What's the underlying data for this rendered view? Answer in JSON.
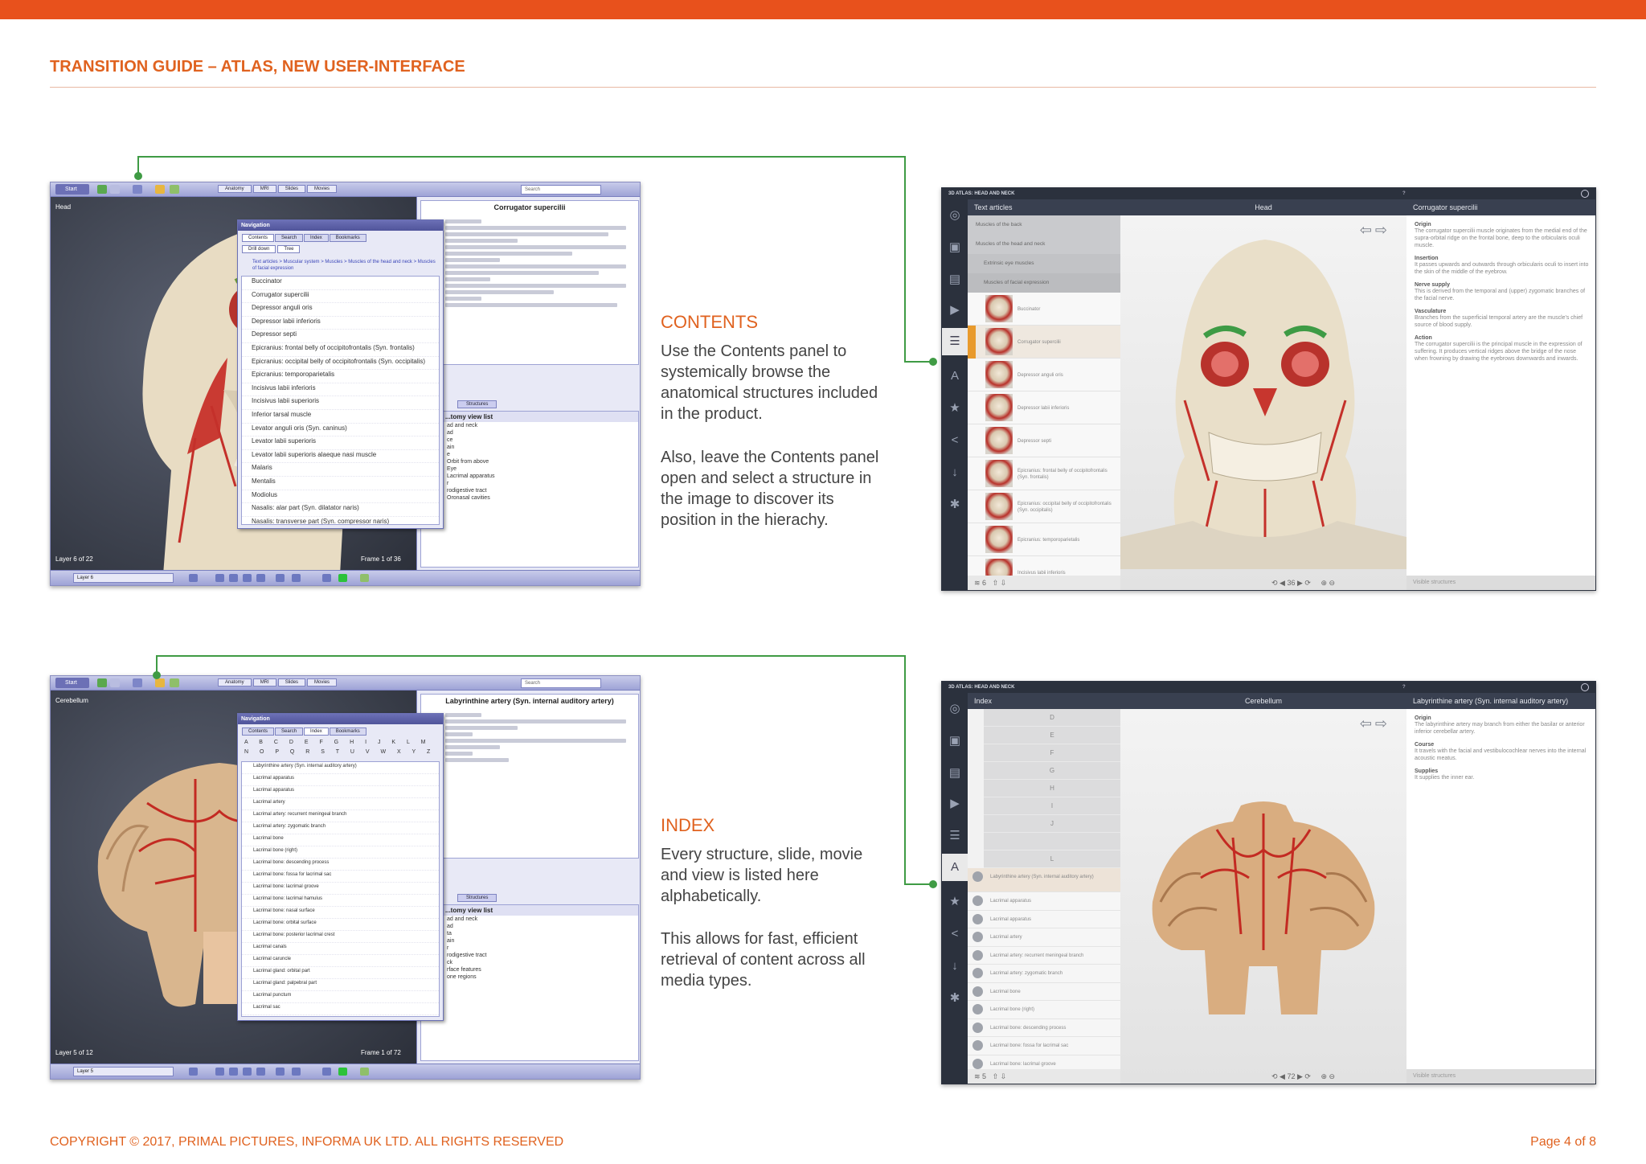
{
  "header": {
    "title": "TRANSITION GUIDE – ATLAS, NEW USER-INTERFACE"
  },
  "footer": {
    "copyright": "COPYRIGHT © 2017, PRIMAL PICTURES, INFORMA UK LTD. ALL RIGHTS RESERVED",
    "page": "Page 4 of  8"
  },
  "colors": {
    "accent": "#e8511c",
    "connector": "#3f9b44"
  },
  "contents_section": {
    "heading": "CONTENTS",
    "para1": "Use the Contents panel to systemically browse the anatomical structures included in the product.",
    "para2": "Also, leave the Contents panel open and select a structure in the image to discover its position in the hierachy."
  },
  "index_section": {
    "heading": "INDEX",
    "para1": "Every structure, slide, movie and view is listed here alphabetically.",
    "para2": "This allows for fast, efficient retrieval of content across all media types."
  },
  "old_ui": {
    "start": "Start",
    "tabs": [
      "Anatomy",
      "MRI",
      "Slides",
      "Movies"
    ],
    "search_placeholder": "Search",
    "nav_title": "Navigation",
    "nav_tabs": [
      "Contents",
      "Search",
      "Index",
      "Bookmarks"
    ],
    "structures_tab": "Structures",
    "view_list_title": "...tomy view list",
    "contents": {
      "view_label": "Head",
      "layer_status": "Layer 6 of 22",
      "frame_status": "Frame 1 of 36",
      "layer_select": "Layer 6",
      "article_title": "Corrugator supercilii",
      "sub_tabs": [
        "Drill down",
        "Tree"
      ],
      "breadcrumb": "Text articles > Muscular system > Muscles > Muscles of the head and neck > Muscles of facial expression",
      "items": [
        "Buccinator",
        "Corrugator supercilii",
        "Depressor anguli oris",
        "Depressor labii inferioris",
        "Depressor septi",
        "Epicranius: frontal belly of occipitofrontalis (Syn. frontalis)",
        "Epicranius: occipital belly of occipitofrontalis (Syn. occipitalis)",
        "Epicranius: temporoparietalis",
        "Incisivus labii inferioris",
        "Incisivus labii superioris",
        "Inferior tarsal muscle",
        "Levator anguli oris (Syn. caninus)",
        "Levator labii superioris",
        "Levator labii superioris alaeque nasi muscle",
        "Malaris",
        "Mentalis",
        "Modiolus",
        "Nasalis: alar part (Syn. dilatator naris)",
        "Nasalis: transverse part (Syn. compressor naris)"
      ],
      "view_list": [
        "ad and neck",
        "ad",
        "ce",
        "ain",
        "e",
        "Orbit from above",
        "Eye",
        "Lacrimal apparatus",
        "r",
        "rodigestive tract",
        "Oronasal cavities"
      ]
    },
    "index": {
      "view_label": "Cerebellum",
      "layer_status": "Layer 5 of 12",
      "frame_status": "Frame 1 of 72",
      "layer_select": "Layer 5",
      "article_title": "Labyrinthine artery (Syn. internal auditory artery)",
      "alphabet": "A B C D E F G H I J K L M N O P Q R S T U V W X Y Z",
      "items": [
        "Labyrinthine artery (Syn. internal auditory artery)",
        "Lacrimal apparatus",
        "Lacrimal apparatus",
        "Lacrimal artery",
        "Lacrimal artery: recurrent meningeal branch",
        "Lacrimal artery: zygomatic branch",
        "Lacrimal bone",
        "Lacrimal bone (right)",
        "Lacrimal bone: descending process",
        "Lacrimal bone: fossa for lacrimal sac",
        "Lacrimal bone: lacrimal groove",
        "Lacrimal bone: lacrimal hamulus",
        "Lacrimal bone: nasal surface",
        "Lacrimal bone: orbital surface",
        "Lacrimal bone: posterior lacrimal crest",
        "Lacrimal canals",
        "Lacrimal caruncle",
        "Lacrimal gland: orbital part",
        "Lacrimal gland: palpebral part",
        "Lacrimal punctum",
        "Lacrimal sac"
      ],
      "view_list": [
        "ad and neck",
        "ad",
        "ta",
        "ain",
        "r",
        "rodigestive tract",
        "ck",
        "rface features",
        "one regions"
      ]
    }
  },
  "new_ui": {
    "app_title": "3D ATLAS: HEAD AND NECK",
    "visible_structures": "Visible structures",
    "contents": {
      "left_header": "Text articles",
      "mid_header": "Head",
      "right_header": "Corrugator supercilii",
      "frame": "36",
      "layer": "6",
      "tree": [
        "Muscles of the back",
        "Muscles of the head and neck",
        "Extrinsic eye muscles",
        "Muscles of facial expression"
      ],
      "thumbs": [
        "Buccinator",
        "Corrugator supercilii",
        "Depressor anguli oris",
        "Depressor labii inferioris",
        "Depressor septi",
        "Epicranius: frontal belly of occipitofrontalis (Syn. frontalis)",
        "Epicranius: occipital belly of occipitofrontalis (Syn. occipitalis)",
        "Epicranius: temporoparietalis",
        "Incisivus labii inferioris"
      ],
      "article": [
        {
          "t": "Origin",
          "b": "The corrugator supercilii muscle originates from the medial end of the supra-orbital ridge on the frontal bone, deep to the orbicularis oculi muscle."
        },
        {
          "t": "Insertion",
          "b": "It passes upwards and outwards through orbicularis oculi to insert into the skin of the middle of the eyebrow."
        },
        {
          "t": "Nerve supply",
          "b": "This is derived from the temporal and (upper) zygomatic branches of the facial nerve."
        },
        {
          "t": "Vasculature",
          "b": "Branches from the superficial temporal artery are the muscle's chief source of blood supply."
        },
        {
          "t": "Action",
          "b": "The corrugator supercilii is the principal muscle in the expression of suffering. It produces vertical ridges above the bridge of the nose when frowning by drawing the eyebrows downwards and inwards."
        }
      ]
    },
    "index": {
      "left_header": "Index",
      "mid_header": "Cerebellum",
      "right_header": "Labyrinthine artery (Syn. internal auditory artery)",
      "frame": "72",
      "layer": "5",
      "letters": [
        "D",
        "E",
        "F",
        "G",
        "H",
        "I",
        "J",
        "",
        "L"
      ],
      "items": [
        "Labyrinthine artery (Syn. internal auditory artery)",
        "Lacrimal apparatus",
        "Lacrimal apparatus",
        "Lacrimal artery",
        "Lacrimal artery: recurrent meningeal branch",
        "Lacrimal artery: zygomatic branch",
        "Lacrimal bone",
        "Lacrimal bone (right)",
        "Lacrimal bone: descending process",
        "Lacrimal bone: fossa for lacrimal sac",
        "Lacrimal bone: lacrimal groove"
      ],
      "article": [
        {
          "t": "Origin",
          "b": "The labyrinthine artery may branch from either the basilar or anterior inferior cerebellar artery."
        },
        {
          "t": "Course",
          "b": "It travels with the facial and vestibulocochlear nerves into the internal acoustic meatus."
        },
        {
          "t": "Supplies",
          "b": "It supplies the inner ear."
        }
      ]
    }
  }
}
